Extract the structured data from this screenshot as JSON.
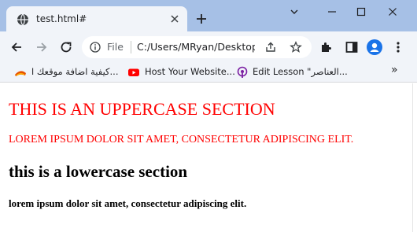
{
  "browser": {
    "tab": {
      "title": "test.html#",
      "favicon_icon": "globe-icon"
    },
    "window_controls": [
      "chevron-down-icon",
      "minimize-icon",
      "maximize-icon",
      "close-icon"
    ],
    "address_bar": {
      "scheme_label": "File",
      "url": "C:/Users/MRyan/Desktop/test.html#"
    },
    "bookmarks": [
      {
        "label": "كيفية اضافة موقعك ا...",
        "icon": "bookmark-favicon-icon",
        "accent": "#e65100"
      },
      {
        "label": "Host Your Website...",
        "icon": "youtube-icon",
        "accent": "#ff0000"
      },
      {
        "label": "Edit Lesson \"العناصر...",
        "icon": "podcast-icon",
        "accent": "#7b1fa2"
      }
    ],
    "bookmarks_overflow": "»"
  },
  "page": {
    "uppercase_heading": "THIS IS AN UPPERCASE SECTION",
    "uppercase_paragraph": "LOREM IPSUM DOLOR SIT AMET, CONSECTETUR ADIPISCING ELIT.",
    "lowercase_heading": "this is a lowercase section",
    "lowercase_paragraph": "lorem ipsum dolor sit amet, consectetur adipiscing elit.",
    "colors": {
      "uppercase_text": "#ff0000",
      "lowercase_text": "#000000"
    }
  }
}
